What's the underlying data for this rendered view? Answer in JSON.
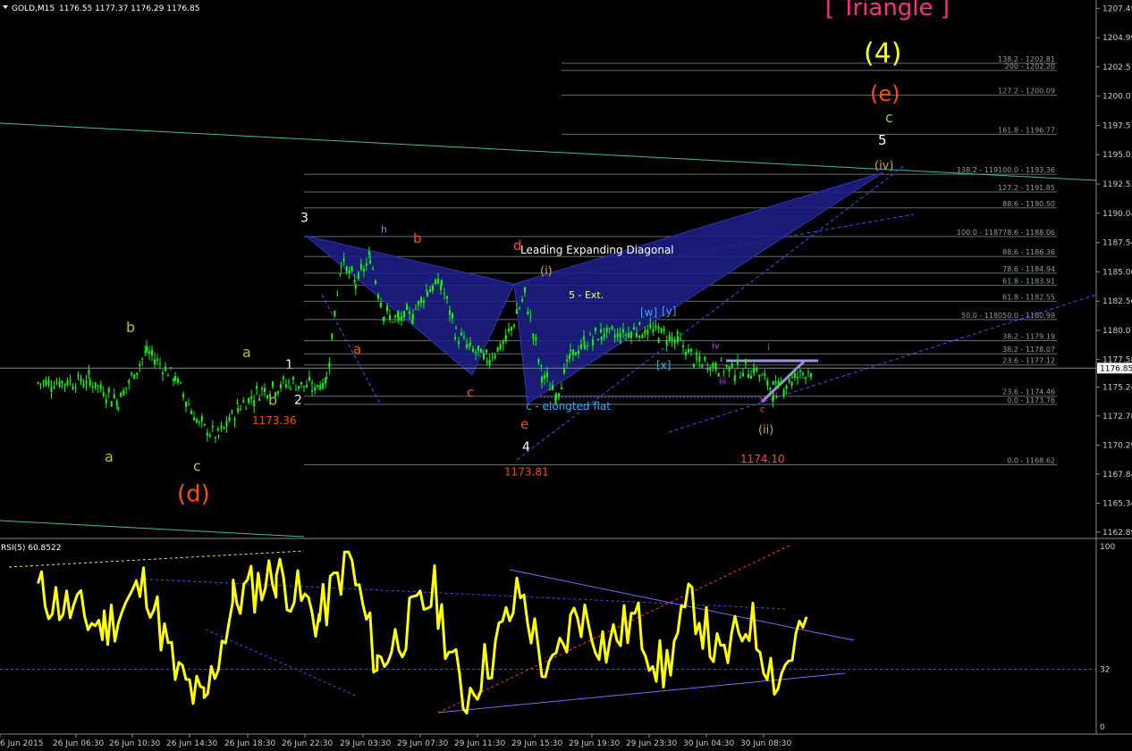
{
  "header": {
    "symbol": "GOLD,M15",
    "ohlc": "1176.55 1177.37 1176.29 1176.85"
  },
  "rsi_header": "RSI(5) 60.8522",
  "colors": {
    "background": "#000000",
    "candle": "#00ff00",
    "rsi_line": "#ffff00",
    "triangle_title": "#ff2d8a",
    "wave4": "#ffff00",
    "wave_e": "#ff4a10",
    "pattern_fill": "#1e1e8c",
    "fib_line": "#5f6f6f",
    "channel_line": "#4a4aff"
  },
  "annotations": [
    {
      "text": "[ Triangle ]",
      "x_time": "29 Jun 23:30",
      "y_price": 1206.9,
      "color": "#ff2d8a",
      "size": 26
    },
    {
      "text": "(4)",
      "x_time": "29 Jun 23:30",
      "y_price": 1202.9,
      "color": "#ffff00",
      "size": 30
    },
    {
      "text": "(e)",
      "x_time": "29 Jun 23:30",
      "y_price": 1199.6,
      "color": "#ff4a10",
      "size": 24
    },
    {
      "text": "c",
      "x_time": "29 Jun 23:30",
      "y_price": 1197.8,
      "color": "#9acd32",
      "size": 16
    },
    {
      "text": "5",
      "x_time": "29 Jun 23:30",
      "y_price": 1195.9,
      "color": "#ffffff",
      "size": 15
    },
    {
      "text": "(iv)",
      "x_time": "29 Jun 23:30",
      "y_price": 1193.8,
      "color": "#d2a050",
      "size": 13
    },
    {
      "text": "(d)",
      "x_time": "26 Jun 14:30",
      "y_price": 1165.5,
      "color": "#ff4a10",
      "size": 26
    },
    {
      "text": "c",
      "x_time": "26 Jun 14:30",
      "y_price": 1168.1,
      "color": "#9acd32",
      "size": 16
    },
    {
      "text": "a",
      "x_time": "26 Jun 06:30",
      "y_price": 1168.9,
      "color": "#9acd32",
      "size": 16
    },
    {
      "text": "b",
      "x_time": "26 Jun 06:30",
      "y_price": 1179.9,
      "color": "#9acd32",
      "size": 16
    },
    {
      "text": "a",
      "x_time": "26 Jun 18:30",
      "y_price": 1177.8,
      "color": "#9acd32",
      "size": 16
    },
    {
      "text": "b",
      "x_time": "26 Jun 18:30",
      "y_price": 1173.7,
      "color": "#9acd32",
      "size": 16
    },
    {
      "text": "1173.36",
      "x_time": "26 Jun 18:30",
      "y_price": 1172.1,
      "color": "#ff4a10",
      "size": 12
    },
    {
      "text": "1",
      "x_time": "26 Jun 22:30",
      "y_price": 1176.8,
      "color": "#ffffff",
      "size": 14
    },
    {
      "text": "2",
      "x_time": "26 Jun 22:30",
      "y_price": 1173.8,
      "color": "#ffffff",
      "size": 14
    },
    {
      "text": "3",
      "x_time": "26 Jun 22:30",
      "y_price": 1189.3,
      "color": "#ffffff",
      "size": 14
    },
    {
      "text": "h",
      "x_time": "29 Jun 03:30",
      "y_price": 1188.4,
      "color": "#33aaff",
      "size": 11
    },
    {
      "text": "a",
      "x_time": "29 Jun 03:30",
      "y_price": 1178.1,
      "color": "#ff4a10",
      "size": 15
    },
    {
      "text": "b",
      "x_time": "29 Jun 07:30",
      "y_price": 1187.5,
      "color": "#ff4a10",
      "size": 15
    },
    {
      "text": "c",
      "x_time": "29 Jun 07:30",
      "y_price": 1174.4,
      "color": "#ff4a10",
      "size": 15
    },
    {
      "text": "d",
      "x_time": "29 Jun 11:30",
      "y_price": 1186.9,
      "color": "#ff4a10",
      "size": 15
    },
    {
      "text": "e",
      "x_time": "29 Jun 11:30",
      "y_price": 1171.7,
      "color": "#ff4a10",
      "size": 15
    },
    {
      "text": "4",
      "x_time": "29 Jun 11:30",
      "y_price": 1169.8,
      "color": "#ffffff",
      "size": 14
    },
    {
      "text": "1173.81",
      "x_time": "29 Jun 11:30",
      "y_price": 1167.7,
      "color": "#ff4a10",
      "size": 12
    },
    {
      "text": "Leading Expanding Diagonal",
      "x_time": "29 Jun 15:30",
      "y_price": 1186.6,
      "color": "#ffffff",
      "size": 12
    },
    {
      "text": "(i)",
      "x_time": "29 Jun 15:30",
      "y_price": 1184.8,
      "color": "#d2a050",
      "size": 13
    },
    {
      "text": "5 - Ext.",
      "x_time": "29 Jun 15:30",
      "y_price": 1182.8,
      "color": "#ffff66",
      "size": 11
    },
    {
      "text": "c - elongted flat",
      "x_time": "29 Jun 15:30",
      "y_price": 1173.3,
      "color": "#33aaff",
      "size": 12
    },
    {
      "text": "[w]",
      "x_time": "29 Jun 19:30",
      "y_price": 1181.3,
      "color": "#33aaff",
      "size": 12
    },
    {
      "text": "[y]",
      "x_time": "29 Jun 23:30",
      "y_price": 1181.4,
      "color": "#33aaff",
      "size": 12
    },
    {
      "text": "[x]",
      "x_time": "29 Jun 23:30",
      "y_price": 1176.8,
      "color": "#33aaff",
      "size": 12
    },
    {
      "text": "(ii)",
      "x_time": "30 Jun 04:30",
      "y_price": 1171.3,
      "color": "#d2a050",
      "size": 13
    },
    {
      "text": "1174.10",
      "x_time": "30 Jun 04:30",
      "y_price": 1168.8,
      "color": "#ff4a10",
      "size": 12
    },
    {
      "text": "iv",
      "x_time": "30 Jun 04:30",
      "y_price": 1178.5,
      "color": "#cc33ff",
      "size": 10
    },
    {
      "text": "iii",
      "x_time": "30 Jun 04:30",
      "y_price": 1175.5,
      "color": "#cc33ff",
      "size": 10
    },
    {
      "text": "v",
      "x_time": "30 Jun 08:30",
      "y_price": 1174.0,
      "color": "#cc33ff",
      "size": 10
    },
    {
      "text": "c",
      "x_time": "30 Jun 08:30",
      "y_price": 1173.1,
      "color": "#ff4a10",
      "size": 10
    },
    {
      "text": "i",
      "x_time": "30 Jun 08:30",
      "y_price": 1178.4,
      "color": "#cc33ff",
      "size": 10
    },
    {
      "text": "ii",
      "x_time": "30 Jun 08:30",
      "y_price": 1174.2,
      "color": "#9acd32",
      "size": 10
    }
  ],
  "chart_data": [
    {
      "type": "line",
      "subtype": "candlestick",
      "title": "GOLD,M15",
      "x_ticks": [
        "6 Jun 2015",
        "26 Jun 06:30",
        "26 Jun 10:30",
        "26 Jun 14:30",
        "26 Jun 18:30",
        "26 Jun 22:30",
        "29 Jun 03:30",
        "29 Jun 07:30",
        "29 Jun 11:30",
        "29 Jun 15:30",
        "29 Jun 19:30",
        "29 Jun 23:30",
        "30 Jun 04:30",
        "30 Jun 08:30"
      ],
      "y_ticks": [
        1207.49,
        1204.99,
        1202.51,
        1200.01,
        1197.51,
        1195.03,
        1192.53,
        1190.04,
        1187.54,
        1185.06,
        1182.56,
        1180.07,
        1177.58,
        1175.24,
        1172.78,
        1170.29,
        1167.84,
        1165.34,
        1162.89
      ],
      "current_price": 1176.85,
      "ylim": [
        1162.5,
        1208.2
      ],
      "close_path": [
        [
          "6 Jun 2015",
          1175.6
        ],
        [
          "26 Jun 06:30",
          1175.8
        ],
        [
          "26 Jun 06:30",
          1174.0
        ],
        [
          "26 Jun 10:30",
          1178.3
        ],
        [
          "26 Jun 10:30",
          1176.0
        ],
        [
          "26 Jun 14:30",
          1172.0
        ],
        [
          "26 Jun 14:30",
          1171.0
        ],
        [
          "26 Jun 14:30",
          1173.5
        ],
        [
          "26 Jun 18:30",
          1175.0
        ],
        [
          "26 Jun 18:30",
          1175.6
        ],
        [
          "26 Jun 22:30",
          1175.2
        ],
        [
          "26 Jun 22:30",
          1175.9
        ],
        [
          "26 Jun 22:30",
          1186.0
        ],
        [
          "26 Jun 22:30",
          1184.0
        ],
        [
          "29 Jun 03:30",
          1186.3
        ],
        [
          "29 Jun 03:30",
          1181.4
        ],
        [
          "29 Jun 03:30",
          1180.9
        ],
        [
          "29 Jun 03:30",
          1181.5
        ],
        [
          "29 Jun 07:30",
          1183.6
        ],
        [
          "29 Jun 07:30",
          1184.0
        ],
        [
          "29 Jun 07:30",
          1179.8
        ],
        [
          "29 Jun 07:30",
          1178.5
        ],
        [
          "29 Jun 11:30",
          1177.6
        ],
        [
          "29 Jun 11:30",
          1179.2
        ],
        [
          "29 Jun 11:30",
          1183.2
        ],
        [
          "29 Jun 15:30",
          1176.3
        ],
        [
          "29 Jun 15:30",
          1174.6
        ],
        [
          "29 Jun 15:30",
          1177.8
        ],
        [
          "29 Jun 15:30",
          1179.0
        ],
        [
          "29 Jun 19:30",
          1179.8
        ],
        [
          "29 Jun 19:30",
          1179.6
        ],
        [
          "29 Jun 19:30",
          1180.2
        ],
        [
          "29 Jun 23:30",
          1179.9
        ],
        [
          "29 Jun 23:30",
          1179.2
        ],
        [
          "29 Jun 23:30",
          1177.4
        ],
        [
          "30 Jun 04:30",
          1177.1
        ],
        [
          "30 Jun 04:30",
          1176.6
        ],
        [
          "30 Jun 04:30",
          1176.8
        ],
        [
          "30 Jun 08:30",
          1175.0
        ],
        [
          "30 Jun 08:30",
          1175.9
        ],
        [
          "30 Jun 08:30",
          1176.85
        ]
      ],
      "fibonacci_levels": [
        {
          "label": "138.2 - 1202.81",
          "value": 1202.81
        },
        {
          "label": "200 - 1202.20",
          "value": 1202.2
        },
        {
          "label": "127.2 - 1200.09",
          "value": 1200.09
        },
        {
          "label": "161.8 - 1196.77",
          "value": 1196.77
        },
        {
          "label": "138.2 - 119100.0 - 1193.36",
          "value": 1193.36
        },
        {
          "label": "127.2 - 1191.85",
          "value": 1191.85
        },
        {
          "label": "88.6 - 1190.50",
          "value": 1190.5
        },
        {
          "label": "100.0 - 118778.6 - 1188.06",
          "value": 1188.06
        },
        {
          "label": "88.6 - 1186.36",
          "value": 1186.36
        },
        {
          "label": "78.6 - 1184.94",
          "value": 1184.94
        },
        {
          "label": "61.8 - 1183.91",
          "value": 1183.91
        },
        {
          "label": "61.8 - 1182.55",
          "value": 1182.55
        },
        {
          "label": "50.0 - 118050.0 - 1180.99",
          "value": 1180.99
        },
        {
          "label": "38.2 - 1179.19",
          "value": 1179.19
        },
        {
          "label": "38.2 - 1178.07",
          "value": 1178.07
        },
        {
          "label": "23.6 - 1177.12",
          "value": 1177.12
        },
        {
          "label": "23.6 - 1174.46",
          "value": 1174.46
        },
        {
          "label": "0.0 - 1173.76",
          "value": 1173.76
        },
        {
          "label": "0.0 - 1168.62",
          "value": 1168.62
        }
      ]
    },
    {
      "type": "line",
      "title": "RSI(5) 60.8522",
      "y_ticks": [
        100,
        32,
        0
      ],
      "ylim": [
        0,
        100
      ],
      "reference_level": 32,
      "last_value": 60.8522,
      "values_path": [
        [
          "6 Jun 2015",
          75
        ],
        [
          "26 Jun 06:30",
          55
        ],
        [
          "26 Jun 10:30",
          80
        ],
        [
          "26 Jun 10:30",
          30
        ],
        [
          "26 Jun 14:30",
          12
        ],
        [
          "26 Jun 14:30",
          70
        ],
        [
          "26 Jun 18:30",
          85
        ],
        [
          "26 Jun 22:30",
          60
        ],
        [
          "26 Jun 22:30",
          95
        ],
        [
          "29 Jun 03:30",
          35
        ],
        [
          "29 Jun 03:30",
          55
        ],
        [
          "29 Jun 07:30",
          75
        ],
        [
          "29 Jun 07:30",
          15
        ],
        [
          "29 Jun 11:30",
          40
        ],
        [
          "29 Jun 11:30",
          75
        ],
        [
          "29 Jun 15:30",
          25
        ],
        [
          "29 Jun 15:30",
          65
        ],
        [
          "29 Jun 19:30",
          45
        ],
        [
          "29 Jun 19:30",
          60
        ],
        [
          "29 Jun 23:30",
          30
        ],
        [
          "29 Jun 23:30",
          70
        ],
        [
          "30 Jun 04:30",
          35
        ],
        [
          "30 Jun 04:30",
          60
        ],
        [
          "30 Jun 08:30",
          25
        ],
        [
          "30 Jun 08:30",
          61
        ]
      ]
    }
  ]
}
